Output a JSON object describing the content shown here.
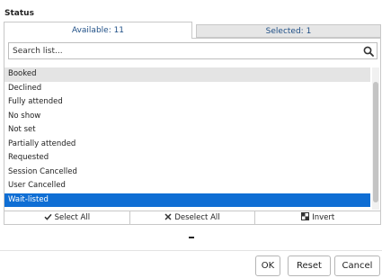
{
  "section": {
    "title": "Status"
  },
  "tabs": {
    "available": "Available: 11",
    "selected": "Selected: 1"
  },
  "search": {
    "placeholder": "Search list...",
    "value": ""
  },
  "items": [
    {
      "label": "Booked",
      "state": "hovered"
    },
    {
      "label": "Declined",
      "state": "normal"
    },
    {
      "label": "Fully attended",
      "state": "normal"
    },
    {
      "label": "No show",
      "state": "normal"
    },
    {
      "label": "Not set",
      "state": "normal"
    },
    {
      "label": "Partially attended",
      "state": "normal"
    },
    {
      "label": "Requested",
      "state": "normal"
    },
    {
      "label": "Session Cancelled",
      "state": "normal"
    },
    {
      "label": "User Cancelled",
      "state": "normal"
    },
    {
      "label": "Wait-listed",
      "state": "active"
    }
  ],
  "actions": {
    "select_all": "Select All",
    "deselect_all": "Deselect All",
    "invert": "Invert"
  },
  "icons": {
    "search": "search-icon",
    "select_all": "check-icon",
    "deselect_all": "x-icon",
    "invert": "invert-icon"
  },
  "colors": {
    "active_item": "#0f6ed4",
    "hovered_item": "#e4e4e4",
    "tab_text": "#1f4f86"
  },
  "footer": {
    "ok": "OK",
    "reset": "Reset",
    "cancel": "Cancel"
  }
}
